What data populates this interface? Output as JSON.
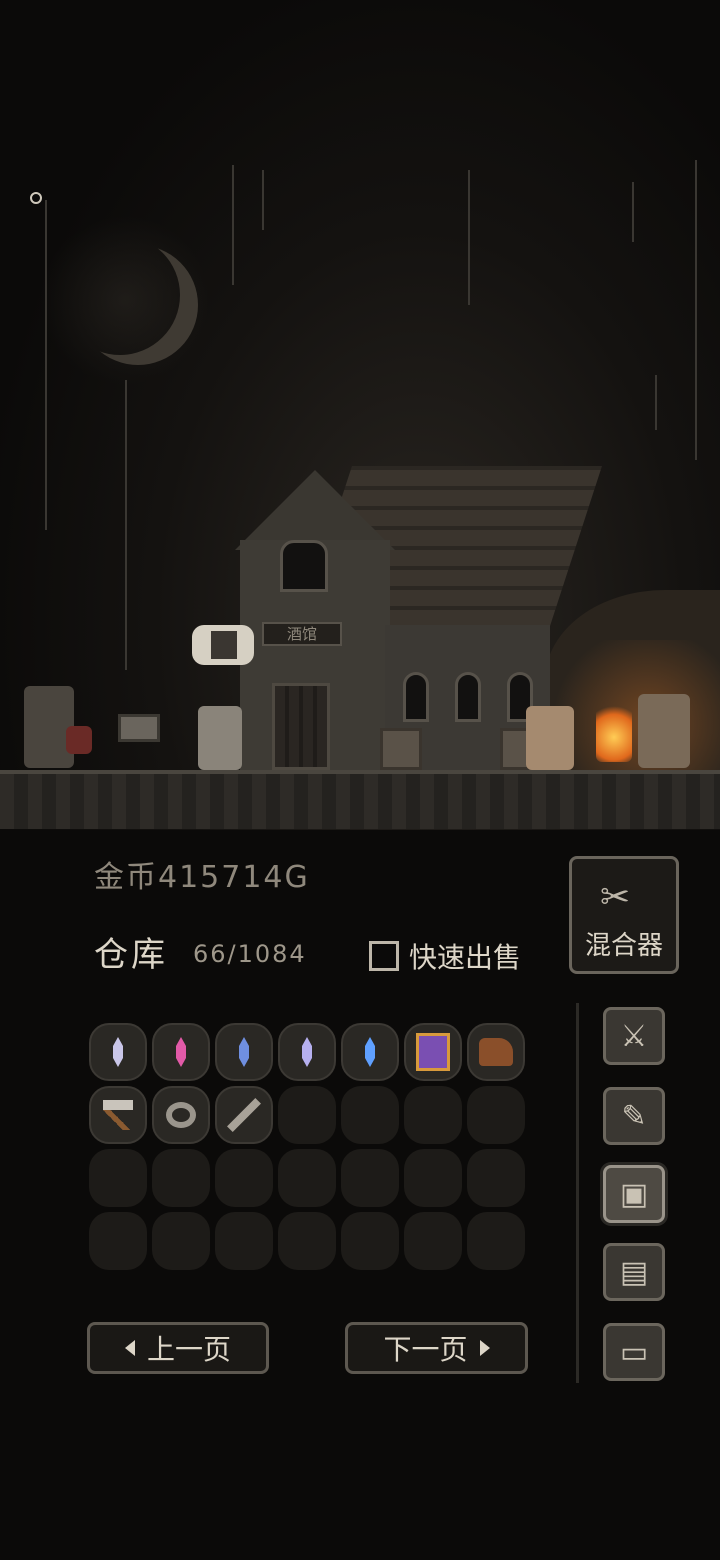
{
  "scene": {
    "sign_text": "酒馆"
  },
  "hud": {
    "gold_label": "金币",
    "gold_value": "415714G",
    "warehouse_label": "仓库",
    "warehouse_count": "66/1084",
    "quick_sell_label": "快速出售",
    "quick_sell_checked": false,
    "mixer_label": "混合器",
    "mixer_icon": "wrench-icon"
  },
  "inventory": {
    "rows": 4,
    "cols": 7,
    "items": [
      {
        "name": "crystal-white-icon",
        "color": "#c9c6e8"
      },
      {
        "name": "crystal-pink-icon",
        "color": "#e25aa8"
      },
      {
        "name": "crystal-blue-icon",
        "color": "#6f8fe0"
      },
      {
        "name": "crystal-lavender-icon",
        "color": "#b6b0ef"
      },
      {
        "name": "crystal-cyan-icon",
        "color": "#5fa0ff"
      },
      {
        "name": "spellbook-icon",
        "color": "#7a4fb2"
      },
      {
        "name": "leather-boot-icon",
        "color": "#8a4f2a"
      },
      {
        "name": "axe-icon",
        "color": "#c9c4bb"
      },
      {
        "name": "ring-icon",
        "color": "#9a958c"
      },
      {
        "name": "dagger-icon",
        "color": "#a8a298"
      }
    ]
  },
  "side_menu": [
    {
      "name": "crossed-swords-icon",
      "glyph": "⚔",
      "active": false
    },
    {
      "name": "scroll-quill-icon",
      "glyph": "✎",
      "active": false
    },
    {
      "name": "map-icon",
      "glyph": "▣",
      "active": true
    },
    {
      "name": "documents-icon",
      "glyph": "▤",
      "active": false
    },
    {
      "name": "computer-icon",
      "glyph": "▭",
      "active": false
    }
  ],
  "pagination": {
    "prev_label": "上一页",
    "next_label": "下一页"
  }
}
